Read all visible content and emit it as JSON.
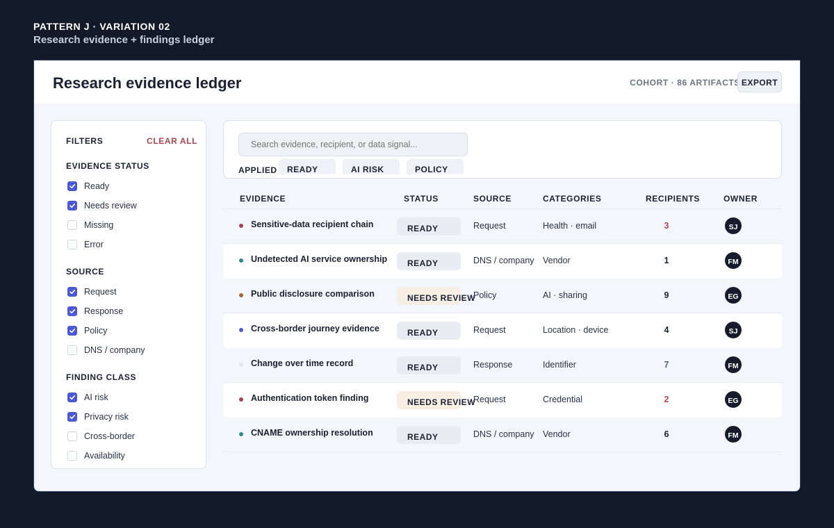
{
  "header": {
    "kicker": "PATTERN J · VARIATION 02",
    "subtitle": "Research evidence + findings ledger"
  },
  "page": {
    "title": "Research evidence ledger",
    "cohort": "COHORT · 86 ARTIFACTS",
    "export_label": "EXPORT"
  },
  "filters": {
    "title": "FILTERS",
    "clear_label": "CLEAR ALL",
    "groups": [
      {
        "title": "EVIDENCE STATUS",
        "options": [
          {
            "label": "Ready",
            "checked": true
          },
          {
            "label": "Needs review",
            "checked": true
          },
          {
            "label": "Missing",
            "checked": false
          },
          {
            "label": "Error",
            "checked": false
          }
        ]
      },
      {
        "title": "SOURCE",
        "options": [
          {
            "label": "Request",
            "checked": true
          },
          {
            "label": "Response",
            "checked": true
          },
          {
            "label": "Policy",
            "checked": true
          },
          {
            "label": "DNS / company",
            "checked": false
          }
        ]
      },
      {
        "title": "FINDING CLASS",
        "options": [
          {
            "label": "AI risk",
            "checked": true
          },
          {
            "label": "Privacy risk",
            "checked": true
          },
          {
            "label": "Cross-border",
            "checked": false
          },
          {
            "label": "Availability",
            "checked": false
          }
        ]
      }
    ]
  },
  "search": {
    "placeholder": "Search evidence, recipient, or data signal...",
    "applied_label": "APPLIED",
    "chips": [
      "READY",
      "AI RISK",
      "POLICY"
    ]
  },
  "table": {
    "columns": [
      "EVIDENCE",
      "STATUS",
      "SOURCE",
      "CATEGORIES",
      "RECIPIENTS",
      "OWNER"
    ],
    "rows": [
      {
        "title": "Sensitive-data recipient chain",
        "dot": "#a9414f",
        "status": "READY",
        "source": "Request",
        "categories": "Health · email",
        "recipients": "3",
        "recip_color": "#b0454f",
        "owner": "SJ"
      },
      {
        "title": "Undetected AI service ownership",
        "dot": "#2e8b8c",
        "status": "READY",
        "source": "DNS / company",
        "categories": "Vendor",
        "recipients": "1",
        "recip_color": "#1b2132",
        "owner": "FM"
      },
      {
        "title": "Public disclosure comparison",
        "dot": "#a3683a",
        "status": "NEEDS REVIEW",
        "source": "Policy",
        "categories": "AI · sharing",
        "recipients": "9",
        "recip_color": "#1b2132",
        "owner": "EG"
      },
      {
        "title": "Cross-border journey evidence",
        "dot": "#4d58d6",
        "status": "READY",
        "source": "Request",
        "categories": "Location · device",
        "recipients": "4",
        "recip_color": "#1b2132",
        "owner": "SJ"
      },
      {
        "title": "Change over time record",
        "dot": "#e2e6ee",
        "status": "READY",
        "source": "Response",
        "categories": "Identifier",
        "recipients": "7",
        "recip_color": "#56608f",
        "owner": "FM"
      },
      {
        "title": "Authentication token finding",
        "dot": "#a9414f",
        "status": "NEEDS REVIEW",
        "source": "Request",
        "categories": "Credential",
        "recipients": "2",
        "recip_color": "#b0454f",
        "owner": "EG"
      },
      {
        "title": "CNAME ownership resolution",
        "dot": "#2e8b8c",
        "status": "READY",
        "source": "DNS / company",
        "categories": "Vendor",
        "recipients": "6",
        "recip_color": "#1b2132",
        "owner": "FM"
      }
    ]
  }
}
